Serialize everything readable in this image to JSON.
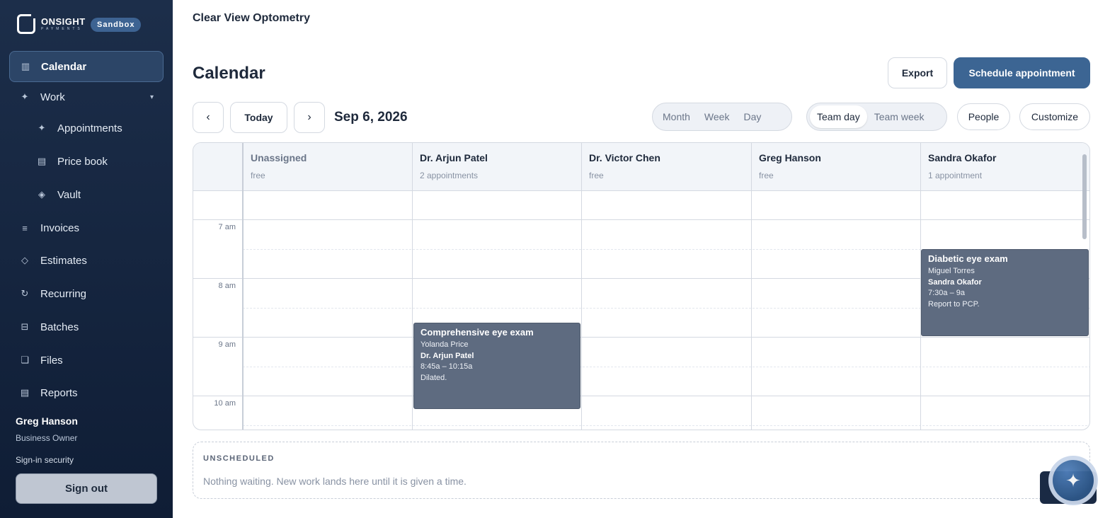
{
  "brand": {
    "name": "ONSIGHT",
    "sub": "PAYMENTS",
    "env_badge": "Sandbox"
  },
  "nav": {
    "calendar": "Calendar",
    "work": "Work",
    "appointments": "Appointments",
    "price_book": "Price book",
    "vault": "Vault",
    "invoices": "Invoices",
    "estimates": "Estimates",
    "recurring": "Recurring",
    "batches": "Batches",
    "files": "Files",
    "reports": "Reports"
  },
  "user": {
    "name": "Greg Hanson",
    "role": "Business Owner",
    "security": "Sign-in security",
    "sign_out": "Sign out"
  },
  "org_title": "Clear View Optometry",
  "page_title": "Calendar",
  "actions": {
    "export": "Export",
    "schedule": "Schedule appointment"
  },
  "toolbar": {
    "prev": "‹",
    "today": "Today",
    "next": "›",
    "date": "Sep 6, 2026",
    "views": [
      "Month",
      "Week",
      "Day"
    ],
    "team_views": [
      "Team day",
      "Team week"
    ],
    "active_team_view": "Team day",
    "people": "People",
    "customize": "Customize"
  },
  "columns": [
    {
      "name": "Unassigned",
      "summary": "free"
    },
    {
      "name": "Dr. Arjun Patel",
      "summary": "2 appointments"
    },
    {
      "name": "Dr. Victor Chen",
      "summary": "free"
    },
    {
      "name": "Greg Hanson",
      "summary": "free"
    },
    {
      "name": "Sandra Okafor",
      "summary": "1 appointment"
    }
  ],
  "times": [
    "7 am",
    "8 am",
    "9 am",
    "10 am"
  ],
  "events": [
    {
      "title": "Comprehensive eye exam",
      "client": "Yolanda Price",
      "provider": "Dr. Arjun Patel",
      "time": "8:45a – 10:15a",
      "note": "Dilated."
    },
    {
      "title": "Diabetic eye exam",
      "client": "Miguel Torres",
      "provider": "Sandra Okafor",
      "time": "7:30a – 9a",
      "note": "Report to PCP."
    }
  ],
  "unscheduled": {
    "title": "UNSCHEDULED",
    "text": "Nothing waiting. New work lands here until it is given a time."
  },
  "colors": {
    "sidebar": "#1c2e4a",
    "primary": "#3c6593",
    "event": "#5e6b80"
  }
}
